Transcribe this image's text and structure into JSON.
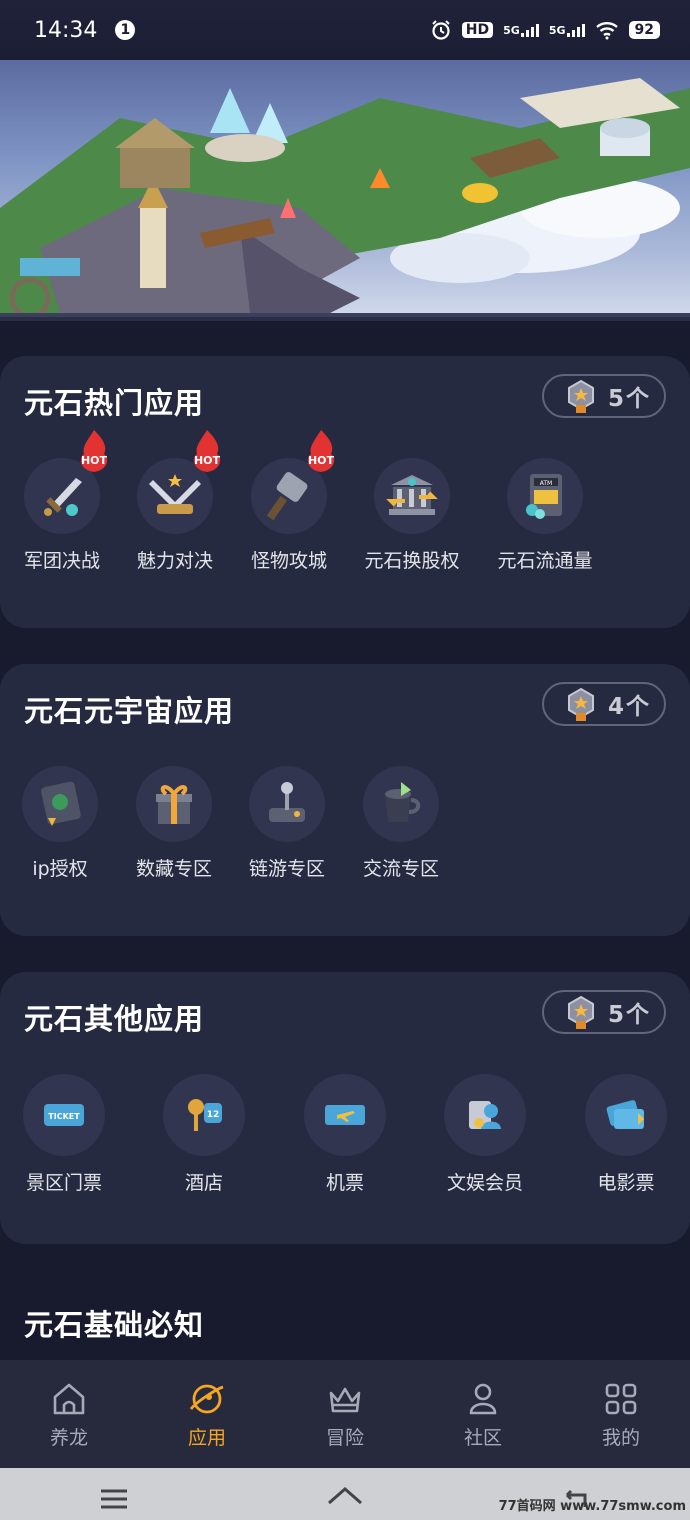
{
  "status_bar": {
    "time": "14:34",
    "notification_count": "1",
    "network_1": "5G",
    "network_2": "5G",
    "hd_label": "HD",
    "battery": "92"
  },
  "sections": [
    {
      "title": "元石热门应用",
      "count": "5个",
      "apps": [
        {
          "label": "军团决战",
          "icon": "sword-icon",
          "hot": true
        },
        {
          "label": "魅力对决",
          "icon": "crossed-swords-icon",
          "hot": true
        },
        {
          "label": "怪物攻城",
          "icon": "hammer-icon",
          "hot": true
        },
        {
          "label": "元石换股权",
          "icon": "bank-exchange-icon",
          "hot": false
        },
        {
          "label": "元石流通量",
          "icon": "atm-icon",
          "hot": false
        }
      ]
    },
    {
      "title": "元石元宇宙应用",
      "count": "4个",
      "apps": [
        {
          "label": "ip授权",
          "icon": "license-book-icon"
        },
        {
          "label": "数藏专区",
          "icon": "gift-box-icon"
        },
        {
          "label": "链游专区",
          "icon": "joystick-icon"
        },
        {
          "label": "交流专区",
          "icon": "cup-icon"
        }
      ]
    },
    {
      "title": "元石其他应用",
      "count": "5个",
      "apps": [
        {
          "label": "景区门票",
          "icon": "ticket-icon"
        },
        {
          "label": "酒店",
          "icon": "hotel-key-icon"
        },
        {
          "label": "机票",
          "icon": "plane-ticket-icon"
        },
        {
          "label": "文娱会员",
          "icon": "member-card-icon"
        },
        {
          "label": "电影票",
          "icon": "cinema-ticket-icon"
        }
      ]
    }
  ],
  "basic_section_title": "元石基础必知",
  "hot_badge": "HOT",
  "atm_text": "ATM",
  "ticket_text": "TICKET",
  "hotel_key_number": "12",
  "tabs": [
    {
      "label": "养龙",
      "icon": "home-icon",
      "active": false
    },
    {
      "label": "应用",
      "icon": "planet-icon",
      "active": true
    },
    {
      "label": "冒险",
      "icon": "crown-icon",
      "active": false
    },
    {
      "label": "社区",
      "icon": "person-icon",
      "active": false
    },
    {
      "label": "我的",
      "icon": "grid-icon",
      "active": false
    }
  ],
  "watermark": "77首码网 www.77smw.com",
  "colors": {
    "background": "#181b2e",
    "card": "#262a40",
    "active_tab": "#f5a623",
    "inactive_tab": "#a7a9b8"
  }
}
